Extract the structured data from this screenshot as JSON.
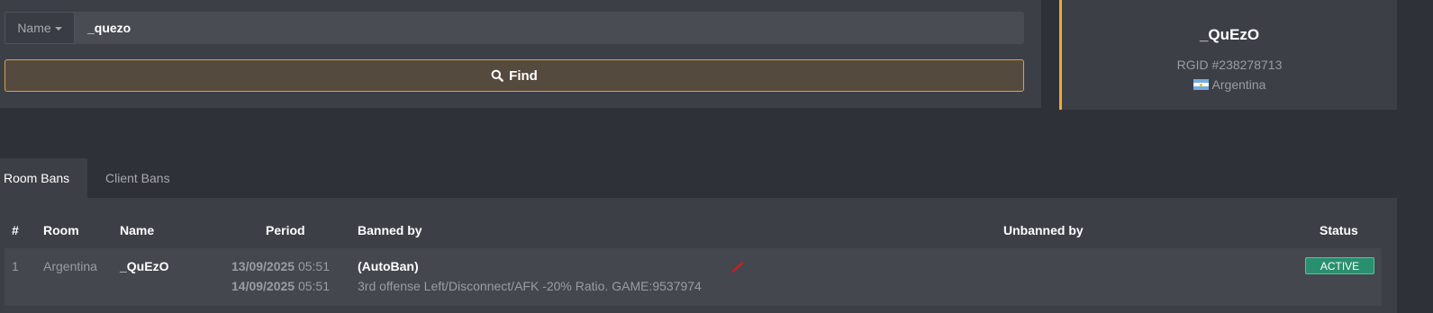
{
  "search": {
    "type_label": "Name",
    "query_value": "_quezo",
    "find_label": "Find"
  },
  "profile": {
    "name": "_QuEzO",
    "rgid": "RGID #238278713",
    "country": "Argentina"
  },
  "tabs": [
    {
      "label": "Room Bans",
      "active": true
    },
    {
      "label": "Client Bans",
      "active": false
    }
  ],
  "table": {
    "headers": {
      "index": "#",
      "room": "Room",
      "name": "Name",
      "period": "Period",
      "banned_by": "Banned by",
      "unbanned_by": "Unbanned by",
      "status": "Status"
    },
    "rows": [
      {
        "index": "1",
        "room": "Argentina",
        "name": "_QuEzO",
        "start_date": "13/09/2025",
        "start_time": "05:51",
        "end_date": "14/09/2025",
        "end_time": "05:51",
        "banned_by": "(AutoBan)",
        "reason": "3rd offense Left/Disconnect/AFK -20% Ratio. GAME:9537974",
        "unbanned_by": "",
        "status": "ACTIVE"
      }
    ]
  },
  "colors": {
    "accent": "#f0a92e",
    "status_active": "#2a8f6e"
  }
}
